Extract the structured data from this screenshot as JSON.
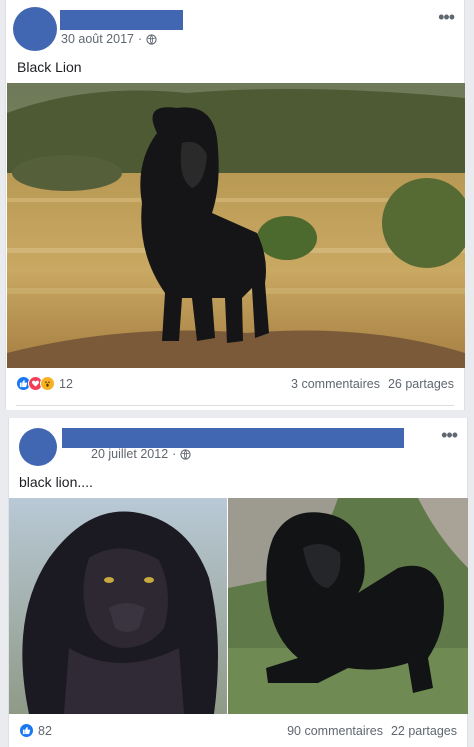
{
  "posts": [
    {
      "date": "30 août 2017",
      "separator": "·",
      "caption": "Black Lion",
      "reaction_icons": [
        "like-icon",
        "love-icon",
        "wow-icon"
      ],
      "reaction_count": "12",
      "comments": "3 commentaires",
      "shares": "26 partages",
      "photos": [
        "black lion standing in savanna"
      ]
    },
    {
      "date": "20 juillet 2012",
      "separator": "·",
      "caption": "black lion....",
      "reaction_icons": [
        "like-icon"
      ],
      "reaction_count": "82",
      "comments": "90 commentaires",
      "shares": "22 partages",
      "photos": [
        "black lion face close-up",
        "black lion lying on grass"
      ]
    }
  ],
  "colors": {
    "brand": "#4267b2",
    "like": "#1877f2",
    "love": "#f33e58",
    "wow": "#f7b125"
  }
}
